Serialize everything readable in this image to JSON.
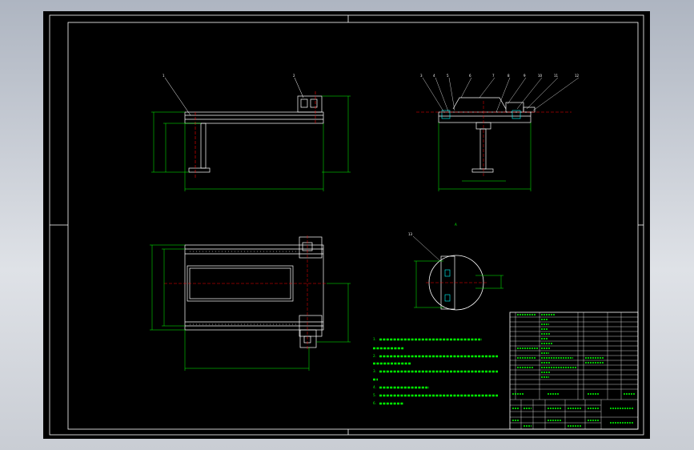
{
  "drawing": {
    "background_color": "#000000",
    "line_color": "#ffffff",
    "dimension_color": "#00ff00",
    "highlight_color": "#ff0000",
    "accent_color": "#00ffff"
  },
  "front_view": {
    "balloons": [
      "1",
      "2"
    ]
  },
  "side_view": {
    "balloons": [
      "3",
      "4",
      "5",
      "6",
      "7",
      "8",
      "9",
      "10",
      "11",
      "12"
    ]
  },
  "plan_view": {},
  "detail_view": {
    "section_mark": "A",
    "balloon": "13"
  },
  "technical_notes": [
    "1.",
    "2.",
    "3.",
    "4.",
    "5.",
    "6."
  ],
  "title_block": {
    "icons": [
      "grid-table-icon"
    ]
  }
}
